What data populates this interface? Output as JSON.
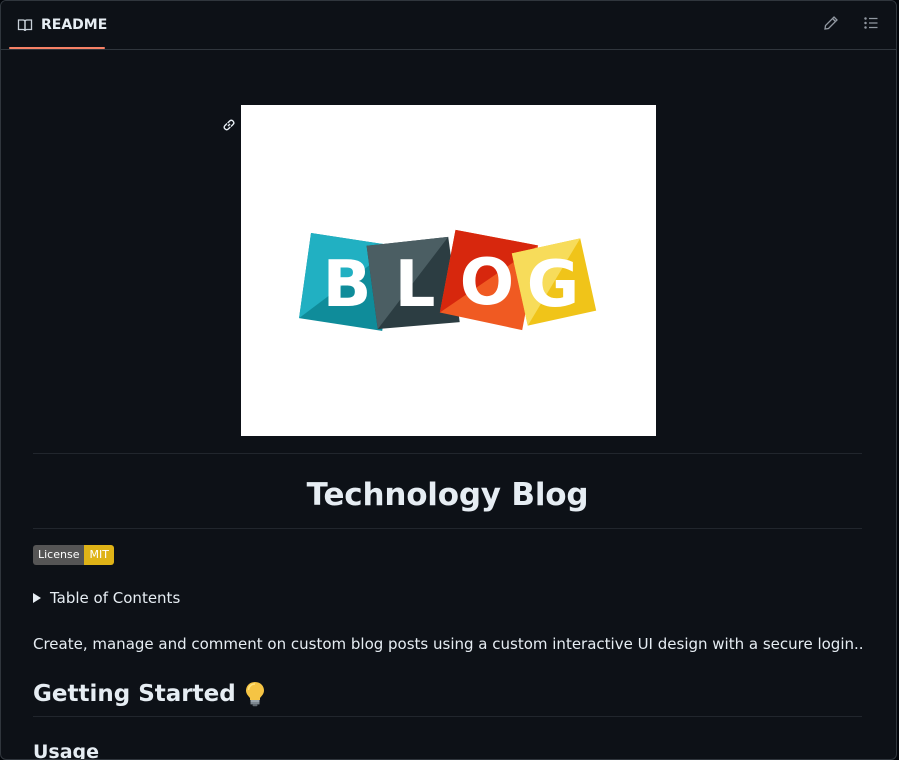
{
  "header": {
    "tab_label": "README",
    "icons": [
      "book-icon",
      "pencil-icon",
      "list-icon"
    ],
    "accent": "#f78166"
  },
  "readme": {
    "hero_letters": [
      "B",
      "L",
      "O",
      "G"
    ],
    "hero_colors": [
      "#1aa3b3",
      "#3e5156",
      "#e23f19",
      "#f2c31d"
    ],
    "title": "Technology Blog",
    "badge": {
      "label": "License",
      "value": "MIT",
      "label_color": "#555555",
      "value_color": "#dfb317"
    },
    "toc_summary": "Table of Contents",
    "description": "Create, manage and comment on custom blog posts using a custom interactive UI design with a secure login..",
    "getting_started": "Getting Started",
    "getting_started_emoji": "lightbulb-icon",
    "usage": "Usage"
  }
}
